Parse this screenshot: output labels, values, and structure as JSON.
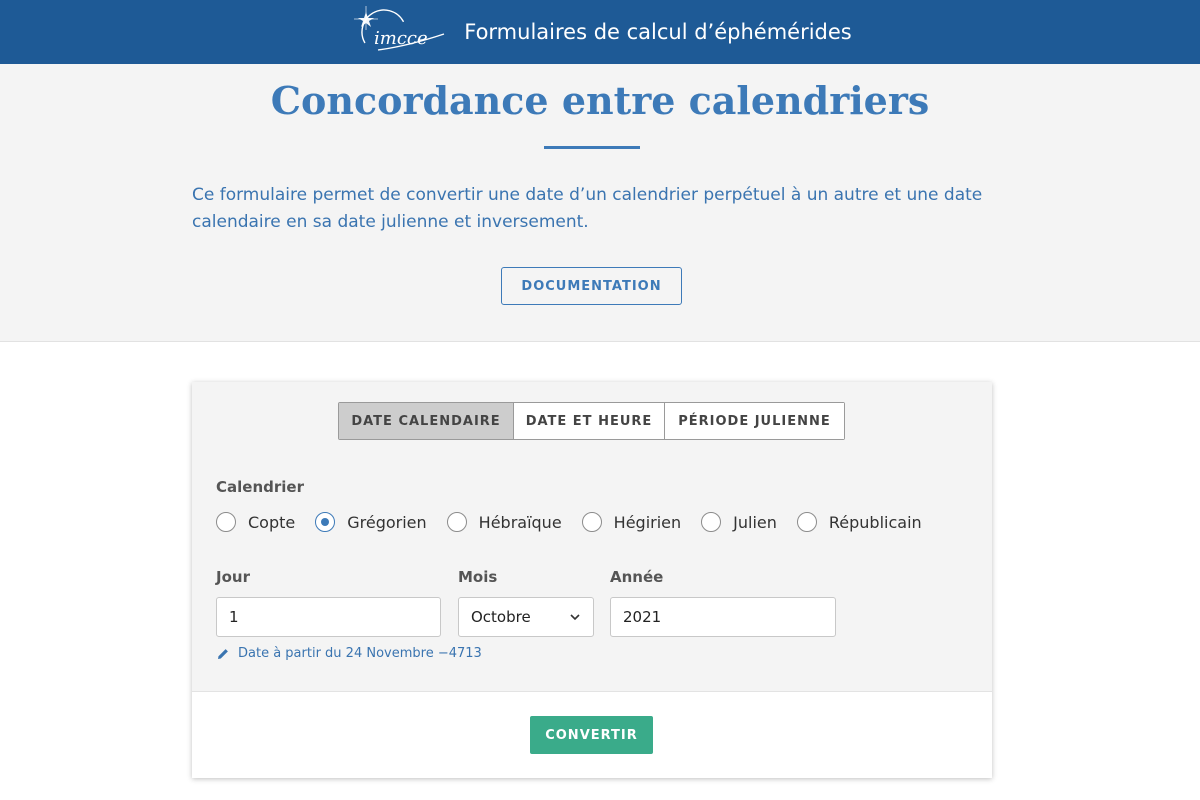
{
  "header": {
    "site_title": "Formulaires de calcul d’éphémérides",
    "logo_text": "imcce",
    "background": "#1e5a96"
  },
  "hero": {
    "title": "Concordance entre calendriers",
    "intro": "Ce formulaire permet de convertir une date d’un calendrier perpétuel à un autre et une date calendaire en sa date julienne et inversement.",
    "documentation_label": "DOCUMENTATION"
  },
  "form": {
    "tabs": [
      {
        "label": "DATE CALENDAIRE",
        "active": true
      },
      {
        "label": "DATE ET HEURE",
        "active": false
      },
      {
        "label": "PÉRIODE JULIENNE",
        "active": false
      }
    ],
    "calendar_label": "Calendrier",
    "calendars": [
      {
        "label": "Copte",
        "checked": false
      },
      {
        "label": "Grégorien",
        "checked": true
      },
      {
        "label": "Hébraïque",
        "checked": false
      },
      {
        "label": "Hégirien",
        "checked": false
      },
      {
        "label": "Julien",
        "checked": false
      },
      {
        "label": "Républicain",
        "checked": false
      }
    ],
    "day": {
      "label": "Jour",
      "value": "1"
    },
    "month": {
      "label": "Mois",
      "value": "Octobre"
    },
    "year": {
      "label": "Année",
      "value": "2021"
    },
    "hint": "Date à partir du 24 Novembre −4713",
    "convert_label": "CONVERTIR"
  },
  "colors": {
    "accent": "#3d7ab8",
    "convert": "#3aab8a"
  },
  "icons": {
    "logo": "imcce-logo",
    "select": "chevron-down-icon",
    "hint": "pencil-icon"
  }
}
